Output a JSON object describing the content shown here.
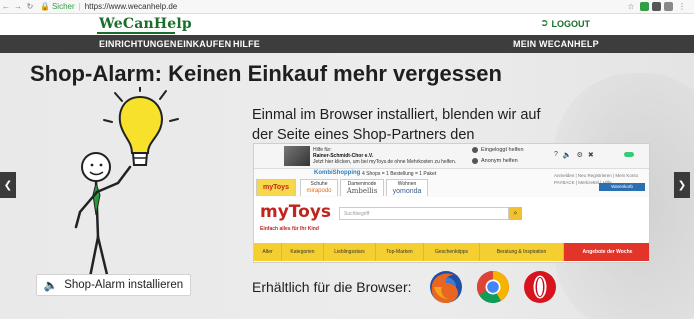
{
  "browser": {
    "secure_label": "Sicher",
    "url": "https://www.wecanhelp.de"
  },
  "header": {
    "logo": "WeCanHelp",
    "logout": "LOGOUT"
  },
  "nav": {
    "items": [
      "EINRICHTUNGEN",
      "EINKAUFEN",
      "HILFE"
    ],
    "account": "MEIN WECANHELP"
  },
  "hero": {
    "headline": "Shop-Alarm: Keinen Einkauf mehr vergessen",
    "subline": "Einmal im Browser installiert, blenden wir auf der Seite eines Shop-Partners den Hilfehinweis ein.",
    "install_button": "Shop-Alarm installieren",
    "browsers_label": "Erhältlich für die Browser:"
  },
  "shop_screenshot": {
    "helfer_line1": "Hilfe für:",
    "helfer_org": "Rainer-Schmidt-Chor e.V.",
    "helfer_line3": "Jetzt hier klicken, um bei myToys.de ohne Mehrkosten zu helfen.",
    "login_option1": "Eingeloggt helfen",
    "login_option2": "Anonym helfen",
    "kombi_label": "KombiShopping",
    "kombi_info": "4 Shops = 1 Bestellung = 1 Paket",
    "shop_tabs": [
      "Schuhe",
      "Damenmode",
      "Wohnen"
    ],
    "shop_tab_brands": [
      "mirapodo",
      "Ambellis",
      "yomonda"
    ],
    "right_links": "Anmelden | Neu Registrieren | Mein Konto",
    "payback": "PAYBACK | Merkzettel | Hilfe",
    "cart": "Warenkorb",
    "mytoys_logo": "myToys",
    "slogan": "Einfach alles für Ihr Kind",
    "search_placeholder": "Suchbegriff",
    "nav_items": [
      "Alter",
      "Kategorien",
      "Lieblingsstars",
      "Top-Marken",
      "Geschenktipps",
      "Beratung & Inspiration",
      "Angebote der Woche"
    ]
  },
  "icons": [
    "firefox-icon",
    "chrome-icon",
    "opera-icon",
    "speaker-icon",
    "logout-icon",
    "lock-icon"
  ],
  "colors": {
    "brand_green": "#1b6d2a",
    "nav_dark": "#3d3d3d",
    "bulb_yellow": "#f7e12a"
  }
}
